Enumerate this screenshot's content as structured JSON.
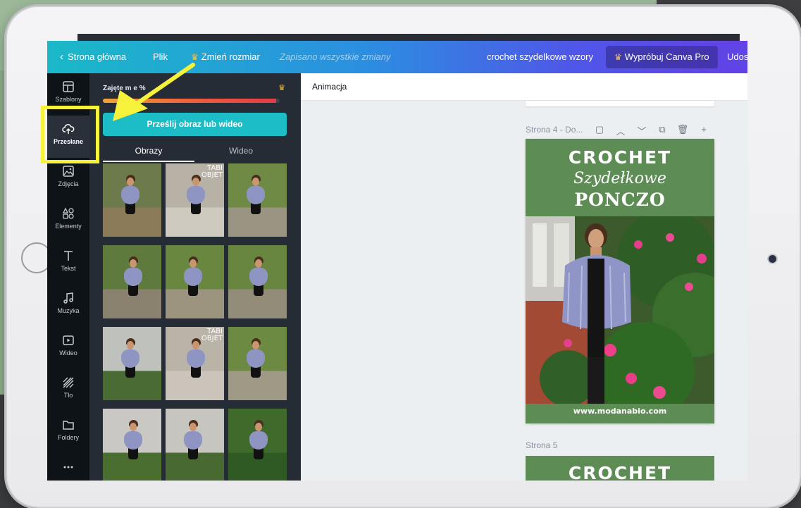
{
  "topbar": {
    "back_label": "Strona główna",
    "file_label": "Plik",
    "resize_label": "Zmień rozmiar",
    "save_status": "Zapisano wszystkie zmiany",
    "doc_title": "crochet szydelkowe wzory",
    "pro_label": "Wypróbuj Canva Pro",
    "share_label": "Udos"
  },
  "rail": {
    "items": [
      {
        "label": "Szablony",
        "icon": "templates-icon"
      },
      {
        "label": "Przesłane",
        "icon": "upload-cloud-icon"
      },
      {
        "label": "Zdjęcia",
        "icon": "photos-icon"
      },
      {
        "label": "Elementy",
        "icon": "elements-icon"
      },
      {
        "label": "Tekst",
        "icon": "text-icon"
      },
      {
        "label": "Muzyka",
        "icon": "music-icon"
      },
      {
        "label": "Wideo",
        "icon": "video-icon"
      },
      {
        "label": "Tło",
        "icon": "background-icon"
      },
      {
        "label": "Foldery",
        "icon": "folder-icon"
      },
      {
        "label": "",
        "icon": "more-icon"
      }
    ]
  },
  "panel": {
    "storage_label": "Zajęte m      e  %",
    "upload_button": "Prześlij obraz lub wideo",
    "tab_images": "Obrazy",
    "tab_video": "Wideo",
    "thumbnails": [
      {
        "name": "thumb-1",
        "sign": ""
      },
      {
        "name": "thumb-2",
        "sign": "TABI\nOBJET"
      },
      {
        "name": "thumb-3",
        "sign": ""
      },
      {
        "name": "thumb-4",
        "sign": ""
      },
      {
        "name": "thumb-5",
        "sign": ""
      },
      {
        "name": "thumb-6",
        "sign": ""
      },
      {
        "name": "thumb-7",
        "sign": ""
      },
      {
        "name": "thumb-8",
        "sign": "TABI\nOBJET"
      },
      {
        "name": "thumb-9",
        "sign": ""
      },
      {
        "name": "thumb-10",
        "sign": ""
      },
      {
        "name": "thumb-11",
        "sign": ""
      },
      {
        "name": "thumb-12",
        "sign": ""
      }
    ]
  },
  "editor": {
    "animation_label": "Animacja",
    "page4_label": "Strona 4 - Do...",
    "page5_label": "Strona 5",
    "design": {
      "title1": "CROCHET",
      "title2": "Szydełkowe",
      "title3": "PONCZO",
      "url": "www.modanabio.com"
    },
    "design2_title": "CROCHET"
  },
  "colors": {
    "accent_teal": "#1dbdc8",
    "highlight_yellow": "#f6f13a",
    "design_green": "#5d8c55",
    "rail_bg": "#0e1318",
    "panel_bg": "#252c35"
  }
}
